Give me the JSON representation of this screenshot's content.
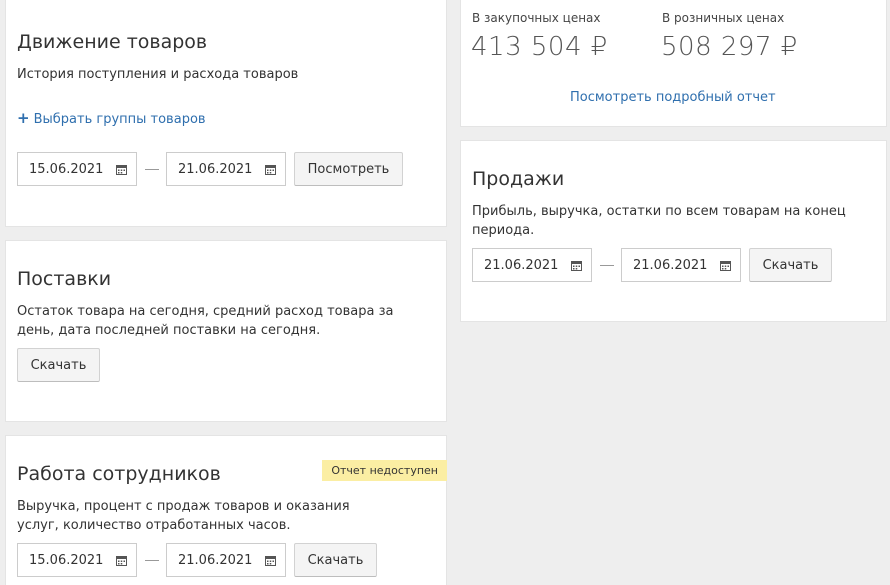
{
  "movement": {
    "title": "Движение товаров",
    "description": "История поступления и расхода товаров",
    "select_groups_label": "Выбрать группы товаров",
    "date_from": "15.06.2021",
    "date_to": "21.06.2021",
    "view_button": "Посмотреть"
  },
  "supplies": {
    "title": "Поставки",
    "description": "Остаток товара на сегодня, средний расход товара за день, дата последней поставки на сегодня.",
    "download_button": "Скачать"
  },
  "employees": {
    "title": "Работа сотрудников",
    "badge": "Отчет недоступен",
    "description": "Выручка, процент с продаж товаров и оказания услуг, количество отработанных часов.",
    "date_from": "15.06.2021",
    "date_to": "21.06.2021",
    "download_button": "Скачать"
  },
  "stock_value": {
    "purchase_label": "В закупочных ценах",
    "purchase_value": "413 504 ₽",
    "retail_label": "В розничных ценах",
    "retail_value": "508 297 ₽",
    "report_link": "Посмотреть подробный отчет"
  },
  "sales": {
    "title": "Продажи",
    "description": "Прибыль, выручка, остатки по всем товарам на конец периода.",
    "date_from": "21.06.2021",
    "date_to": "21.06.2021",
    "download_button": "Скачать"
  },
  "colors": {
    "link": "#2f6fae",
    "badge_bg": "#fbeea3",
    "page_bg": "#eeeeee"
  },
  "icons": {
    "calendar": "calendar-icon",
    "plus": "plus-icon"
  }
}
